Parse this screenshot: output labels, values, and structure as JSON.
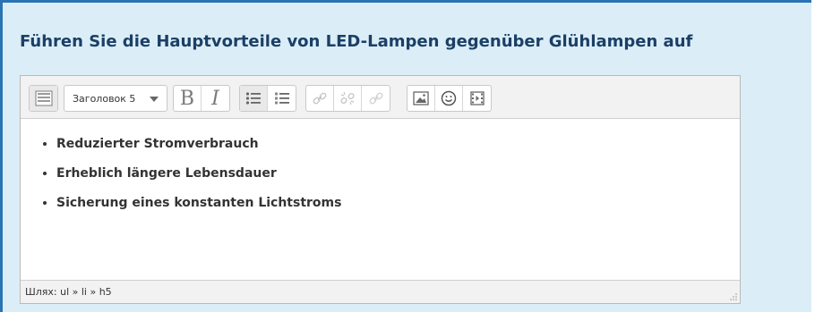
{
  "question": "Führen Sie die Hauptvorteile von LED-Lampen gegenüber Glühlampen auf",
  "toolbar": {
    "format_select_value": "Заголовок 5",
    "bold_label": "B",
    "italic_label": "I"
  },
  "content": {
    "items": [
      "Reduzierter Stromverbrauch",
      "Erheblich längere Lebensdauer",
      "Sicherung eines konstanten Lichtstroms"
    ]
  },
  "statusbar": {
    "path": "Шлях: ul » li » h5"
  }
}
